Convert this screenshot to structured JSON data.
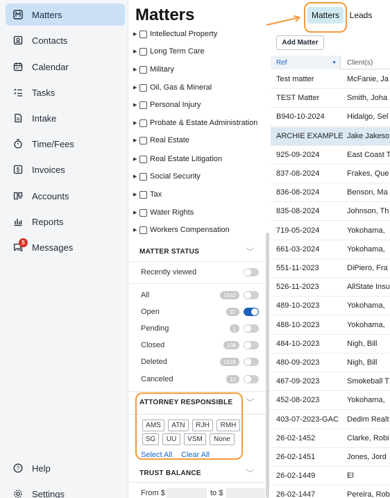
{
  "sidebar": {
    "items": [
      {
        "label": "Matters",
        "icon": "matters-icon"
      },
      {
        "label": "Contacts",
        "icon": "contacts-icon"
      },
      {
        "label": "Calendar",
        "icon": "calendar-icon"
      },
      {
        "label": "Tasks",
        "icon": "tasks-icon"
      },
      {
        "label": "Intake",
        "icon": "intake-icon"
      },
      {
        "label": "Time/Fees",
        "icon": "stopwatch-icon"
      },
      {
        "label": "Invoices",
        "icon": "dollar-icon"
      },
      {
        "label": "Accounts",
        "icon": "accounts-icon"
      },
      {
        "label": "Reports",
        "icon": "reports-icon"
      },
      {
        "label": "Messages",
        "icon": "messages-icon",
        "badge": "5"
      }
    ],
    "help_label": "Help",
    "settings_label": "Settings"
  },
  "header": {
    "title": "Matters",
    "tabs": [
      "Matters",
      "Leads"
    ]
  },
  "filters": {
    "practice_areas": [
      "Intellectual Property",
      "Long Term Care",
      "Military",
      "Oil, Gas & Mineral",
      "Personal Injury",
      "Probate & Estate Administration",
      "Real Estate",
      "Real Estate Litigation",
      "Social Security",
      "Tax",
      "Water Rights",
      "Workers Compensation"
    ],
    "matter_status": {
      "heading": "MATTER STATUS",
      "recently_viewed": "Recently viewed",
      "statuses": [
        {
          "label": "All",
          "count": "1642",
          "on": false
        },
        {
          "label": "Open",
          "count": "97",
          "on": true
        },
        {
          "label": "Pending",
          "count": "1",
          "on": false
        },
        {
          "label": "Closed",
          "count": "108",
          "on": false
        },
        {
          "label": "Deleted",
          "count": "1426",
          "on": false
        },
        {
          "label": "Canceled",
          "count": "10",
          "on": false
        }
      ]
    },
    "attorney_responsible": {
      "heading": "ATTORNEY RESPONSIBLE",
      "chips": [
        "AMS",
        "ATN",
        "RJH",
        "RMH",
        "SG",
        "UU",
        "VSM",
        "None"
      ],
      "select_all": "Select All",
      "clear_all": "Clear All"
    },
    "trust_balance": {
      "heading": "TRUST BALANCE",
      "from_label": "From $",
      "to_label": "to $"
    }
  },
  "list": {
    "add_button": "Add Matter",
    "columns": [
      "Ref",
      "Client(s)"
    ],
    "rows": [
      {
        "ref": "Test matter",
        "client": "McFanie, Ja"
      },
      {
        "ref": "TEST Matter",
        "client": "Smith, Joha"
      },
      {
        "ref": "B940-10-2024",
        "client": "Hidalgo, Sel"
      },
      {
        "ref": "ARCHIE EXAMPLE",
        "client": "Jake Jakeso"
      },
      {
        "ref": "925-09-2024",
        "client": "East Coast T"
      },
      {
        "ref": "837-08-2024",
        "client": "Frakes, Que"
      },
      {
        "ref": "836-08-2024",
        "client": "Benson, Ma"
      },
      {
        "ref": "835-08-2024",
        "client": "Johnson, Th"
      },
      {
        "ref": "719-05-2024",
        "client": "Yokohama,"
      },
      {
        "ref": "661-03-2024",
        "client": "Yokohama,"
      },
      {
        "ref": "551-11-2023",
        "client": "DiPiero, Fra"
      },
      {
        "ref": "526-11-2023",
        "client": "AllState Insu"
      },
      {
        "ref": "489-10-2023",
        "client": "Yokohama,"
      },
      {
        "ref": "488-10-2023",
        "client": "Yokohama,"
      },
      {
        "ref": "484-10-2023",
        "client": "Nigh, Bill"
      },
      {
        "ref": "480-09-2023",
        "client": "Nigh, Bill"
      },
      {
        "ref": "467-09-2023",
        "client": "Smokeball T"
      },
      {
        "ref": "452-08-2023",
        "client": "Yokohama,"
      },
      {
        "ref": "403-07-2023-GAC",
        "client": "Dedim Realt"
      },
      {
        "ref": "26-02-1452",
        "client": "Clarke, Robi"
      },
      {
        "ref": "26-02-1451",
        "client": "Jones, Jord"
      },
      {
        "ref": "26-02-1449",
        "client": "El"
      },
      {
        "ref": "26-02-1447",
        "client": "Pereira, Rob"
      }
    ],
    "selected_row": "ARCHIE EXAMPLE"
  },
  "colors": {
    "active_nav": "#c9e0f6",
    "highlight": "#f59a3c",
    "toggle_on": "#1d5fbf",
    "link": "#1a66c9"
  }
}
